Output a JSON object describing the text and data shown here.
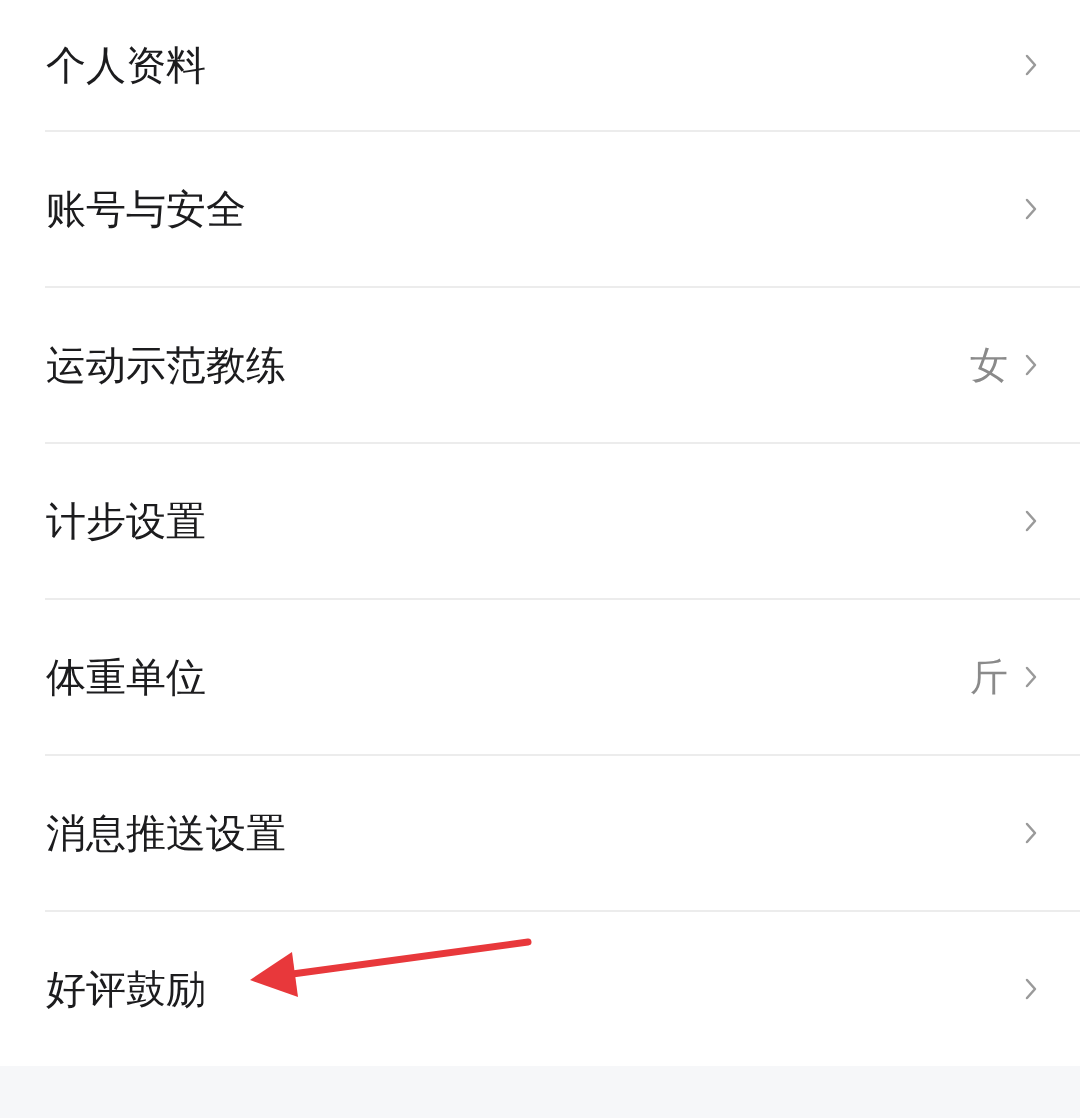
{
  "settings_items": [
    {
      "label": "个人资料"
    },
    {
      "label": "账号与安全"
    },
    {
      "label": "运动示范教练",
      "value": "女"
    },
    {
      "label": "计步设置"
    },
    {
      "label": "体重单位",
      "value": "斤"
    },
    {
      "label": "消息推送设置"
    },
    {
      "label": "好评鼓励"
    }
  ]
}
